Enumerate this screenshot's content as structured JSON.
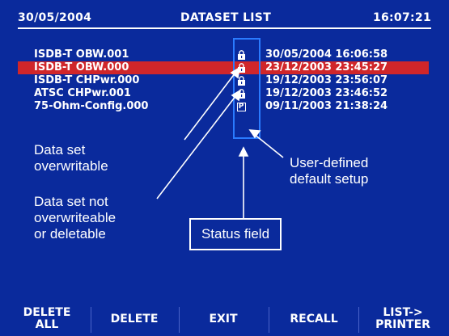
{
  "header": {
    "date": "30/05/2004",
    "title": "DATASET LIST",
    "time": "16:07:21"
  },
  "datasets": [
    {
      "name": "ISDB-T OBW.001",
      "status": "lock",
      "datetime": "30/05/2004 16:06:58",
      "selected": false
    },
    {
      "name": "ISDB-T OBW.000",
      "status": "lock",
      "datetime": "23/12/2003 23:45:27",
      "selected": true
    },
    {
      "name": "ISDB-T CHPwr.000",
      "status": "lock",
      "datetime": "19/12/2003 23:56:07",
      "selected": false
    },
    {
      "name": "ATSC CHPwr.001",
      "status": "lock",
      "datetime": "19/12/2003 23:46:52",
      "selected": false
    },
    {
      "name": "75-Ohm-Config.000",
      "status": "P",
      "datetime": "09/11/2003 21:38:24",
      "selected": false
    }
  ],
  "annotations": {
    "overwritable": "Data set\noverwritable",
    "user_defined": "User-defined\ndefault setup",
    "not_overwriteable": "Data set not\noverwriteable\nor deletable",
    "status_field": "Status field"
  },
  "softkeys": [
    "DELETE\nALL",
    "DELETE",
    "EXIT",
    "RECALL",
    "LIST->\nPRINTER"
  ],
  "colors": {
    "background": "#0a2a9c",
    "selected_row": "#d0262a",
    "status_frame": "#2a7bff",
    "text": "#ffffff"
  }
}
